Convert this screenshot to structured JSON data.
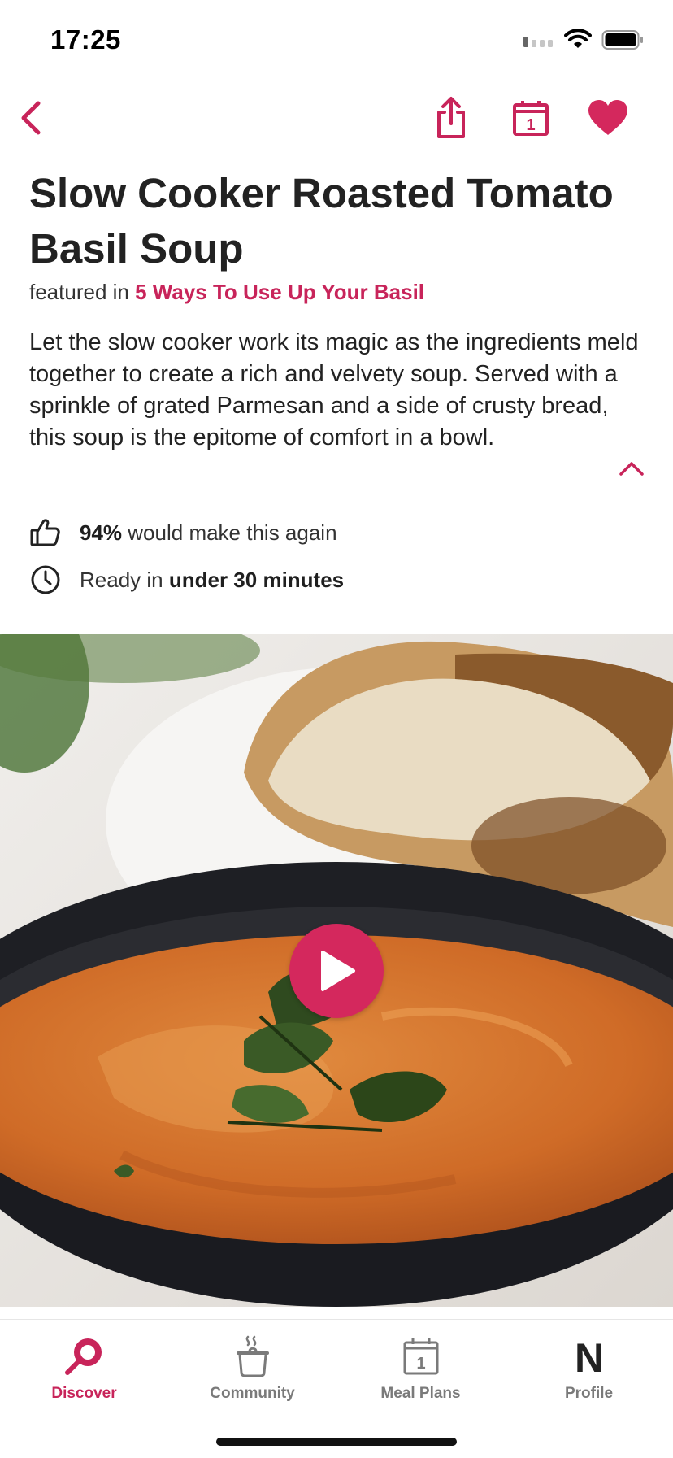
{
  "status": {
    "time": "17:25"
  },
  "colors": {
    "accent": "#c8245a",
    "play": "#d4285d",
    "text": "#222222"
  },
  "nav": {
    "icons": [
      "back-chevron-icon",
      "share-icon",
      "calendar-icon",
      "heart-filled-icon"
    ],
    "calendar_day": "1"
  },
  "recipe": {
    "title": "Slow Cooker Roasted Tomato Basil Soup",
    "featured_prefix": "featured in",
    "featured_link": "5 Ways To Use Up Your Basil",
    "description": "Let the slow cooker work its magic as the ingredients meld together to create a rich and velvety soup. Served with a sprinkle of grated Parmesan and a side of crusty bread, this soup is the epitome of comfort in a bowl.",
    "rating": {
      "percent": "94%",
      "text": "would make this again"
    },
    "time": {
      "prefix": "Ready in",
      "value": "under 30 minutes"
    }
  },
  "tabs": [
    {
      "label": "Discover",
      "icon": "discover-search-icon",
      "active": true
    },
    {
      "label": "Community",
      "icon": "community-pot-icon",
      "active": false
    },
    {
      "label": "Meal Plans",
      "icon": "meal-plans-calendar-icon",
      "active": false,
      "day": "1"
    },
    {
      "label": "Profile",
      "icon": "profile-n-logo-icon",
      "active": false,
      "glyph": "N"
    }
  ]
}
